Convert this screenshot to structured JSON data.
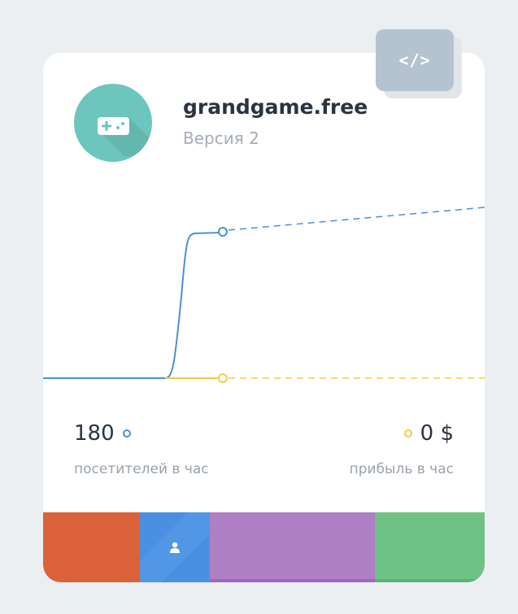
{
  "app": {
    "title": "grandgame.free",
    "version": "Версия 2"
  },
  "embed_button": {
    "label": "</>"
  },
  "stats": {
    "visitors": {
      "value": "180",
      "label": "посетителей в час"
    },
    "profit": {
      "value": "0 $",
      "label": "прибыль в час"
    }
  },
  "chart_data": {
    "type": "line",
    "series": [
      {
        "color": "#4a90d9",
        "style": "solid-then-dashed-forecast"
      },
      {
        "color": "#f2cc4b",
        "style": "solid-then-dashed-forecast"
      }
    ],
    "grid": false
  },
  "footer": {
    "segments": [
      {
        "color": "#db6139"
      },
      {
        "color": "#4a90e2",
        "icon": "user-icon"
      },
      {
        "color": "#ae7fc4"
      },
      {
        "color": "#6fc185"
      }
    ]
  },
  "colors": {
    "background": "#ebeff1",
    "card": "#ffffff",
    "avatar": "#6cc6bd",
    "embed": "#b4c3cf",
    "visitors_line": "#4a90d9",
    "profit_line": "#f2cc4b"
  }
}
